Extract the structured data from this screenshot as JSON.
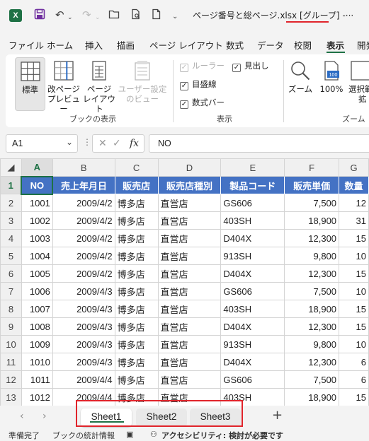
{
  "title_bar": {
    "filename": "ページ番号と総ページ.xlsx",
    "group_label": "[グループ]",
    "suffix": "-···"
  },
  "ribbon_tabs": [
    "ファイル",
    "ホーム",
    "挿入",
    "描画",
    "ページ レイアウト",
    "数式",
    "データ",
    "校閲",
    "表示",
    "開発"
  ],
  "active_tab": "表示",
  "ribbon": {
    "workbook_views": {
      "group_label": "ブックの表示",
      "normal": "標準",
      "page_break_1": "改ページ",
      "page_break_2": "プレビュー",
      "page_layout_1": "ページ",
      "page_layout_2": "レイアウト",
      "custom_1": "ユーザー設定",
      "custom_2": "のビュー"
    },
    "show": {
      "group_label": "表示",
      "ruler": "ルーラー",
      "gridlines": "目盛線",
      "formula_bar": "数式バー",
      "headings": "見出し"
    },
    "zoom": {
      "group_label": "ズーム",
      "zoom": "ズーム",
      "hundred": "100%",
      "selection_1": "選択範",
      "selection_2": "拡"
    }
  },
  "formula_bar": {
    "name_box": "A1",
    "content": "NO"
  },
  "columns": [
    "A",
    "B",
    "C",
    "D",
    "E",
    "F",
    "G"
  ],
  "header_row": [
    "NO",
    "売上年月日",
    "販売店",
    "販売店種別",
    "製品コード",
    "販売単価",
    "数量"
  ],
  "rows": [
    [
      "1001",
      "2009/4/2",
      "博多店",
      "直営店",
      "GS606",
      "7,500",
      "12"
    ],
    [
      "1002",
      "2009/4/2",
      "博多店",
      "直営店",
      "403SH",
      "18,900",
      "31"
    ],
    [
      "1003",
      "2009/4/2",
      "博多店",
      "直営店",
      "D404X",
      "12,300",
      "15"
    ],
    [
      "1004",
      "2009/4/2",
      "博多店",
      "直営店",
      "913SH",
      "9,800",
      "10"
    ],
    [
      "1005",
      "2009/4/2",
      "博多店",
      "直営店",
      "D404X",
      "12,300",
      "15"
    ],
    [
      "1006",
      "2009/4/3",
      "博多店",
      "直営店",
      "GS606",
      "7,500",
      "10"
    ],
    [
      "1007",
      "2009/4/3",
      "博多店",
      "直営店",
      "403SH",
      "18,900",
      "15"
    ],
    [
      "1008",
      "2009/4/3",
      "博多店",
      "直営店",
      "D404X",
      "12,300",
      "15"
    ],
    [
      "1009",
      "2009/4/3",
      "博多店",
      "直営店",
      "913SH",
      "9,800",
      "10"
    ],
    [
      "1010",
      "2009/4/3",
      "博多店",
      "直営店",
      "D404X",
      "12,300",
      "6"
    ],
    [
      "1011",
      "2009/4/4",
      "博多店",
      "直営店",
      "GS606",
      "7,500",
      "6"
    ],
    [
      "1012",
      "2009/4/4",
      "博多店",
      "直営店",
      "403SH",
      "18,900",
      "15"
    ]
  ],
  "row_numbers": [
    "1",
    "2",
    "3",
    "4",
    "5",
    "6",
    "7",
    "8",
    "9",
    "10",
    "11",
    "12",
    "13"
  ],
  "sheets": [
    "Sheet1",
    "Sheet2",
    "Sheet3"
  ],
  "status_bar": {
    "ready": "準備完了",
    "stats": "ブックの統計情報",
    "accessibility": "アクセシビリティ: 検討が必要です"
  },
  "colors": {
    "accent": "#1e7145",
    "header_fill": "#4472c4",
    "highlight": "#e0242b"
  }
}
